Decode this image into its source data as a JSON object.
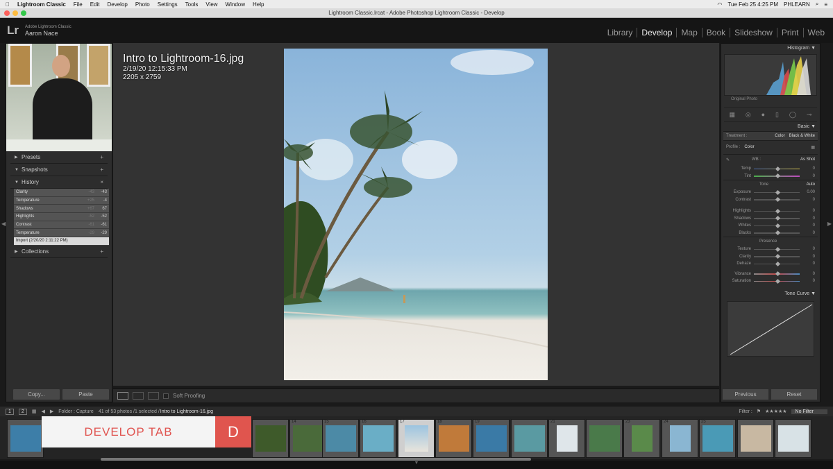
{
  "menubar": {
    "apple": "",
    "app": "Lightroom Classic",
    "items": [
      "File",
      "Edit",
      "Develop",
      "Photo",
      "Settings",
      "Tools",
      "View",
      "Window",
      "Help"
    ],
    "clock": "Tue Feb 25  4:25 PM",
    "user": "PHLEARN"
  },
  "window_title": "Lightroom Classic.lrcat - Adobe Photoshop Lightroom Classic - Develop",
  "identity": {
    "logo": "Lr",
    "product": "Adobe Lightroom Classic",
    "user": "Aaron Nace"
  },
  "modules": [
    "Library",
    "Develop",
    "Map",
    "Book",
    "Slideshow",
    "Print",
    "Web"
  ],
  "active_module": "Develop",
  "left_panel": {
    "presets": "Presets",
    "snapshots": "Snapshots",
    "history": "History",
    "history_items": [
      {
        "name": "Clarity",
        "a": "-43",
        "b": "-43"
      },
      {
        "name": "Temperature",
        "a": "+25",
        "b": "-4"
      },
      {
        "name": "Shadows",
        "a": "+67",
        "b": "67"
      },
      {
        "name": "Highlights",
        "a": "-52",
        "b": "-52"
      },
      {
        "name": "Contrast",
        "a": "-61",
        "b": "-61"
      },
      {
        "name": "Temperature",
        "a": "-29",
        "b": "-29"
      },
      {
        "name": "Import (2/20/20 2:11:22 PM)",
        "a": "",
        "b": ""
      }
    ],
    "collections": "Collections",
    "copy_btn": "Copy...",
    "paste_btn": "Paste"
  },
  "photo_info": {
    "filename": "Intro to Lightroom-16.jpg",
    "date": "2/19/20 12:15:33 PM",
    "dims": "2205 x 2759"
  },
  "toolbar": {
    "soft_proofing": "Soft Proofing"
  },
  "right_panel": {
    "histogram": "Histogram",
    "original_photo": "Original Photo",
    "basic": "Basic",
    "treatment_label": "Treatment :",
    "treatment_color": "Color",
    "treatment_bw": "Black & White",
    "profile_label": "Profile :",
    "profile_value": "Color",
    "wb_label": "WB :",
    "wb_value": "As Shot",
    "tone": "Tone",
    "auto": "Auto",
    "presence": "Presence",
    "sliders_wb": [
      {
        "name": "Temp",
        "value": "0"
      },
      {
        "name": "Tint",
        "value": "0"
      }
    ],
    "sliders_tone": [
      {
        "name": "Exposure",
        "value": "0.00"
      },
      {
        "name": "Contrast",
        "value": "0"
      }
    ],
    "sliders_tone2": [
      {
        "name": "Highlights",
        "value": "0"
      },
      {
        "name": "Shadows",
        "value": "0"
      },
      {
        "name": "Whites",
        "value": "0"
      },
      {
        "name": "Blacks",
        "value": "0"
      }
    ],
    "sliders_presence": [
      {
        "name": "Texture",
        "value": "0"
      },
      {
        "name": "Clarity",
        "value": "0"
      },
      {
        "name": "Dehaze",
        "value": "0"
      }
    ],
    "sliders_presence2": [
      {
        "name": "Vibrance",
        "value": "0"
      },
      {
        "name": "Saturation",
        "value": "0"
      }
    ],
    "tone_curve": "Tone Curve",
    "previous": "Previous",
    "reset": "Reset"
  },
  "filmstrip_bar": {
    "page1": "1",
    "page2": "2",
    "folder": "Folder : Capture",
    "count": "41 of 53 photos /1 selected /",
    "file": "Intro to Lightroom-16.jpg",
    "filter_label": "Filter :",
    "filter_value": "No Filter"
  },
  "filmstrip_numbers": [
    "",
    "",
    "",
    "",
    "",
    "",
    "",
    "14",
    "15",
    "16",
    "17",
    "18",
    "19",
    "",
    "21",
    "",
    "23",
    "24",
    "25",
    ""
  ],
  "banner": {
    "text": "DEVELOP TAB",
    "letter": "D"
  },
  "colors": {
    "accent_red": "#e0554e",
    "panel": "#2d2d2d"
  }
}
